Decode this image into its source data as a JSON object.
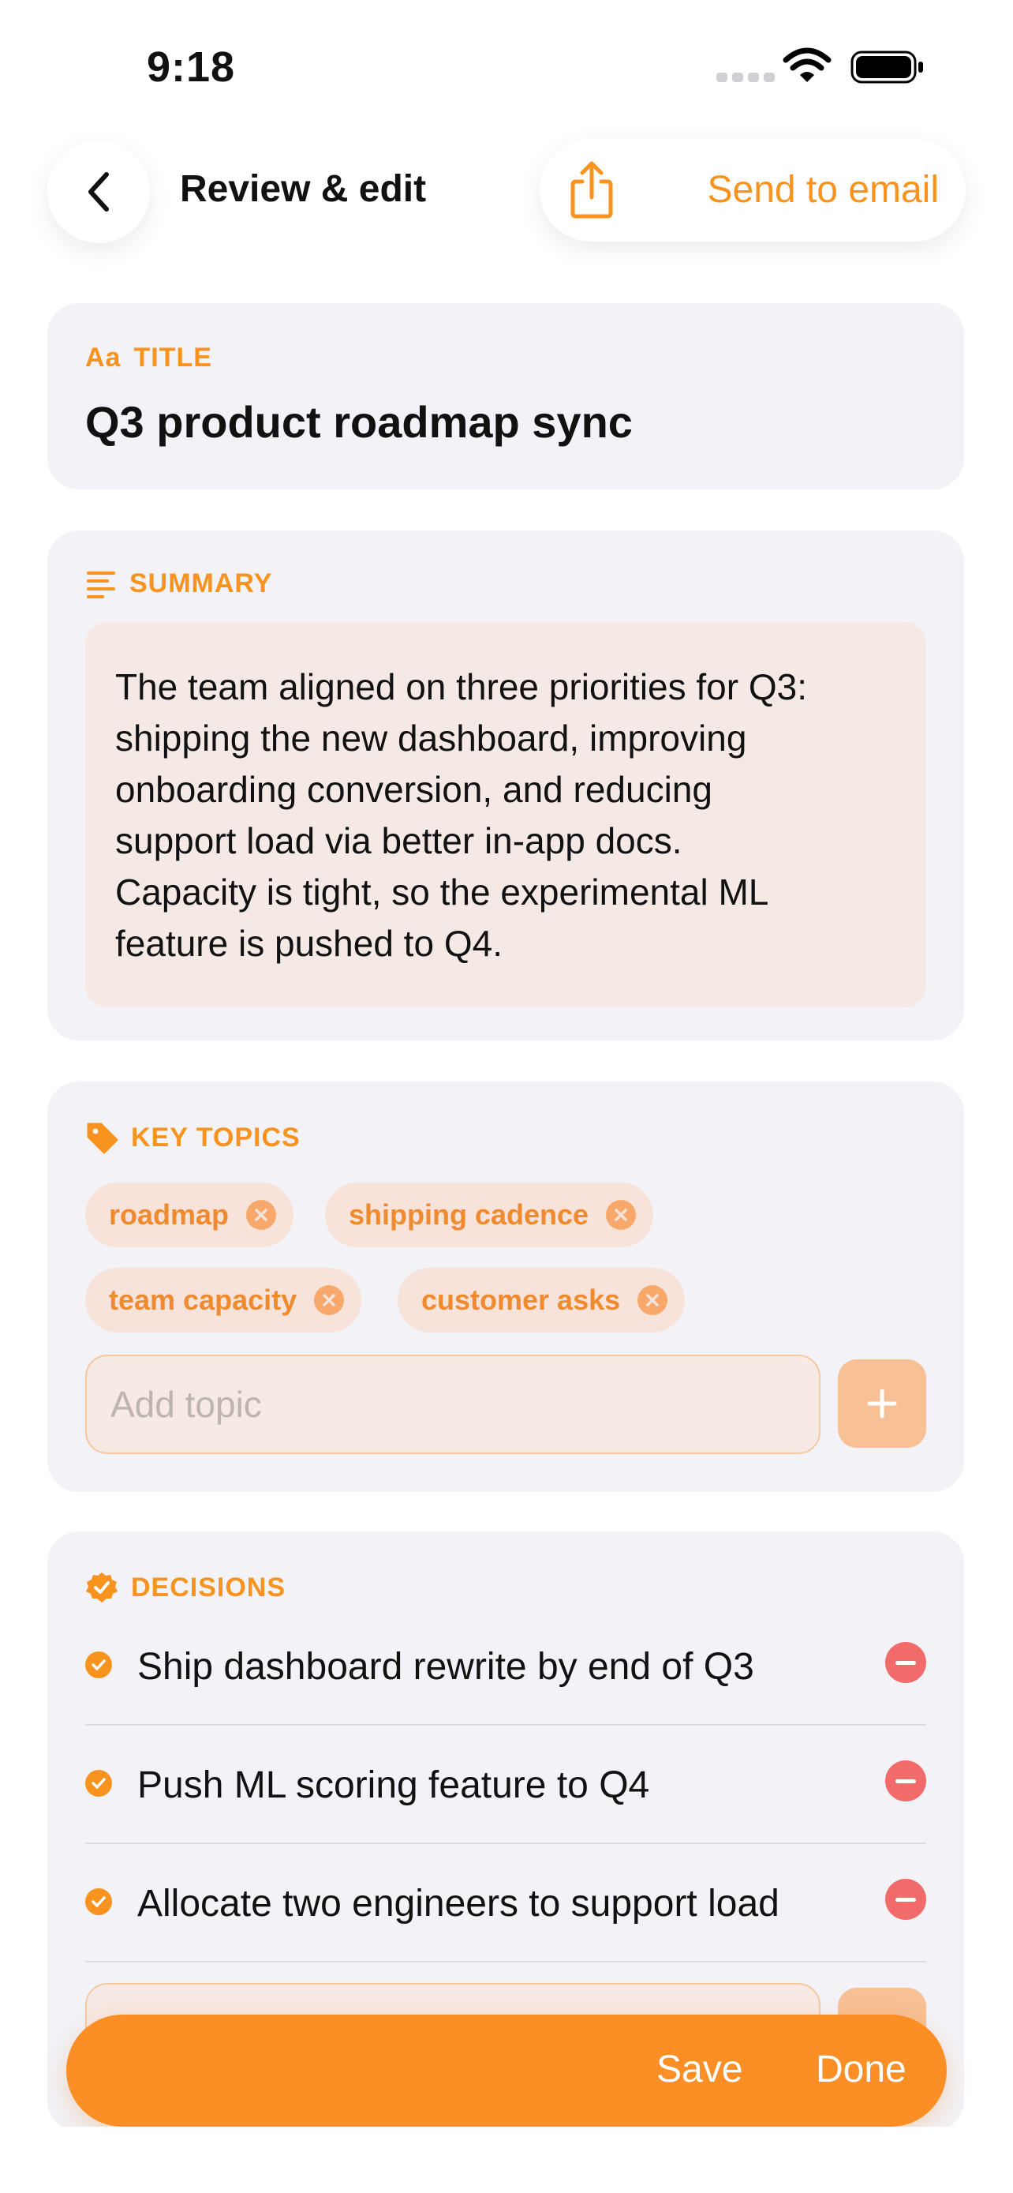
{
  "status_bar": {
    "time": "9:18"
  },
  "header": {
    "title": "Review & edit",
    "send_label": "Send to email"
  },
  "title_section": {
    "label": "TITLE",
    "icon_text": "Aa",
    "value": "Q3 product roadmap sync"
  },
  "summary_section": {
    "label": "SUMMARY",
    "lines": [
      "The team aligned on three priorities for Q3:",
      "shipping the new dashboard, improving",
      "onboarding conversion, and reducing",
      "support load via better in-app docs.",
      "Capacity is tight, so the experimental ML",
      "feature is pushed to Q4."
    ]
  },
  "topics_section": {
    "label": "KEY TOPICS",
    "chips": [
      "roadmap",
      "shipping cadence",
      "team capacity",
      "customer asks"
    ],
    "input_placeholder": "Add topic"
  },
  "decisions_section": {
    "label": "DECISIONS",
    "items": [
      "Ship dashboard rewrite by end of Q3",
      "Push ML scoring feature to Q4",
      "Allocate two engineers to support load"
    ]
  },
  "bottom_bar": {
    "save_label": "Save",
    "done_label": "Done"
  },
  "colors": {
    "accent": "#f7931e",
    "danger": "#f26b6b",
    "card_bg": "#f2f2f7"
  }
}
